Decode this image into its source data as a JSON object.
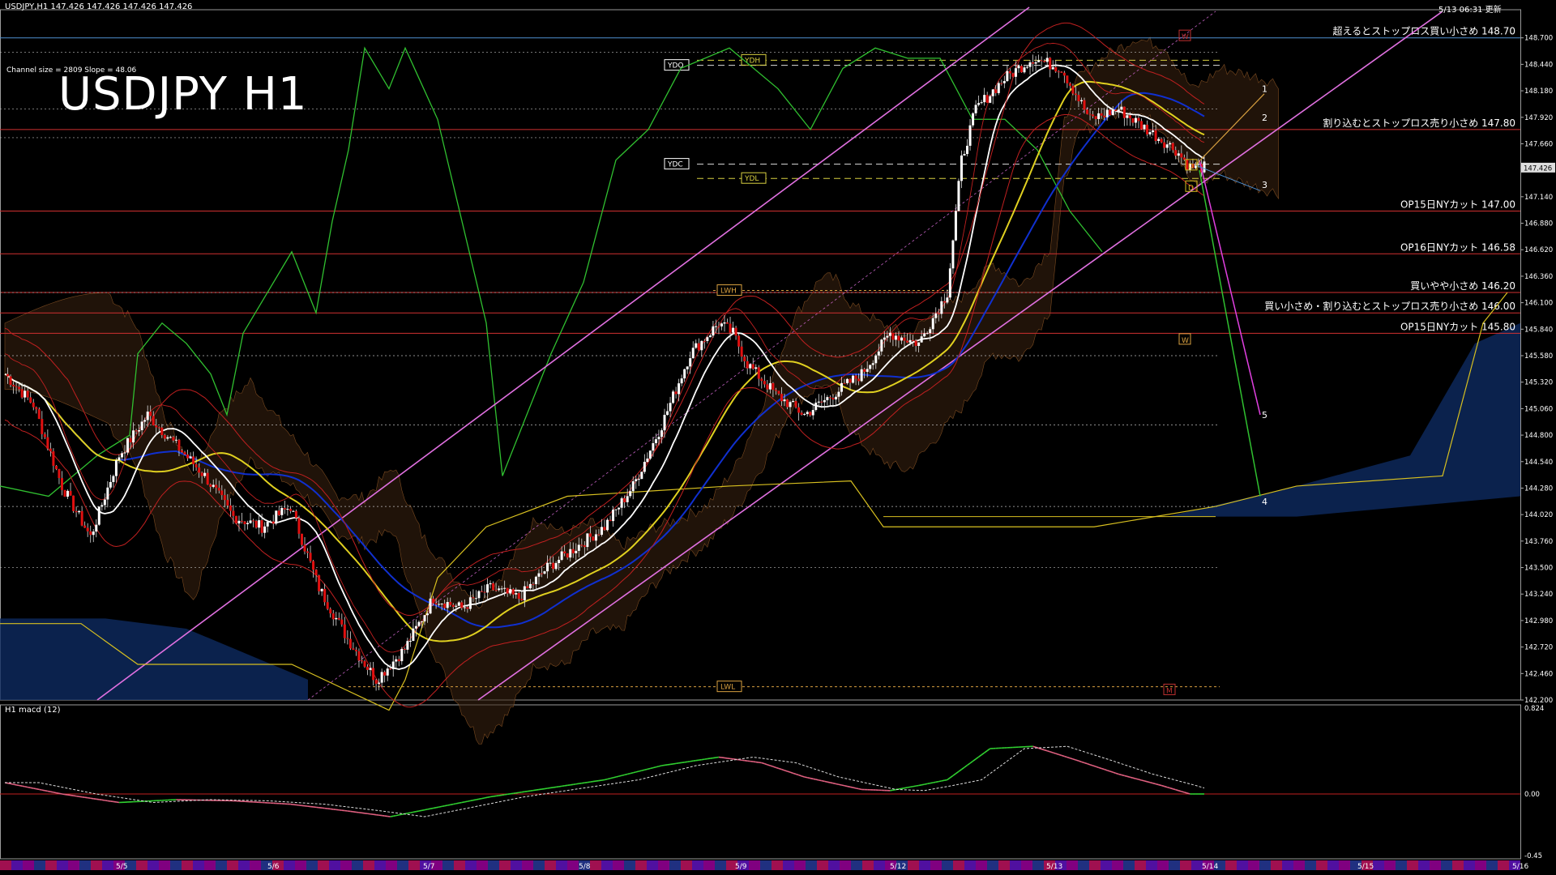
{
  "header": {
    "symbol_line": "USDJPY,H1  147.426 147.426 147.426 147.426",
    "update_time": "5/13 06:31 更新",
    "channel_info": "Channel size = 2809 Slope = 48.06",
    "title": "USDJPY H1",
    "macd_label": "H1  macd (12)"
  },
  "chart_data": {
    "type": "candlestick",
    "title": "USDJPY H1",
    "ylim": [
      142.2,
      148.96
    ],
    "y_ticks": [
      "148.700",
      "148.440",
      "148.180",
      "147.920",
      "147.660",
      "147.426",
      "147.140",
      "146.880",
      "146.620",
      "146.360",
      "146.100",
      "145.840",
      "145.580",
      "145.320",
      "145.060",
      "144.800",
      "144.540",
      "144.280",
      "144.020",
      "143.760",
      "143.500",
      "143.240",
      "142.980",
      "142.720",
      "142.460",
      "142.200"
    ],
    "current_price": "147.426",
    "x_labels": [
      "5/5",
      "5/6",
      "5/7",
      "5/8",
      "5/9",
      "5/12",
      "5/13",
      "5/14",
      "5/15",
      "5/16"
    ],
    "macd_ticks": [
      "0.824",
      "0.00",
      "-0.45"
    ],
    "order_levels": [
      {
        "label": "超えるとストップロス買い小さめ 148.70",
        "price": 148.7,
        "color": "#4f8fd0"
      },
      {
        "label": "割り込むとストップロス売り小さめ 147.80",
        "price": 147.8,
        "color": "#d03030"
      },
      {
        "label": "OP15日NYカット 147.00",
        "price": 147.0,
        "color": "#d03030"
      },
      {
        "label": "OP16日NYカット 146.58",
        "price": 146.58,
        "color": "#d03030"
      },
      {
        "label": "買いやや小さめ 146.20",
        "price": 146.2,
        "color": "#d03030"
      },
      {
        "label": "買い小さめ・割り込むとストップロス売り小さめ 146.00",
        "price": 146.0,
        "color": "#d03030"
      },
      {
        "label": "OP15日NYカット 145.80",
        "price": 145.8,
        "color": "#d03030"
      }
    ],
    "tags": [
      {
        "label": "YDO",
        "price": 148.43
      },
      {
        "label": "YDH",
        "price": 148.48
      },
      {
        "label": "YDC",
        "price": 147.46
      },
      {
        "label": "YDL",
        "price": 147.32
      },
      {
        "label": "LWH",
        "price": 146.22
      },
      {
        "label": "LWL",
        "price": 142.33
      }
    ],
    "markers": [
      "W",
      "D",
      "D",
      "W",
      "M"
    ],
    "wave_labels": [
      "1",
      "2",
      "3",
      "4",
      "5"
    ],
    "anchors": [
      [
        0,
        145.4
      ],
      [
        10,
        145.1
      ],
      [
        20,
        144.3
      ],
      [
        30,
        143.8
      ],
      [
        40,
        144.6
      ],
      [
        50,
        145.0
      ],
      [
        60,
        144.7
      ],
      [
        70,
        144.4
      ],
      [
        80,
        144.0
      ],
      [
        90,
        143.9
      ],
      [
        100,
        144.1
      ],
      [
        110,
        143.3
      ],
      [
        120,
        142.8
      ],
      [
        130,
        142.4
      ],
      [
        140,
        142.7
      ],
      [
        150,
        143.2
      ],
      [
        160,
        143.1
      ],
      [
        170,
        143.3
      ],
      [
        180,
        143.2
      ],
      [
        190,
        143.5
      ],
      [
        200,
        143.7
      ],
      [
        210,
        143.9
      ],
      [
        220,
        144.3
      ],
      [
        230,
        144.9
      ],
      [
        240,
        145.6
      ],
      [
        250,
        145.9
      ],
      [
        255,
        145.8
      ],
      [
        260,
        145.5
      ],
      [
        270,
        145.2
      ],
      [
        280,
        145.0
      ],
      [
        290,
        145.2
      ],
      [
        300,
        145.4
      ],
      [
        310,
        145.8
      ],
      [
        320,
        145.7
      ],
      [
        330,
        146.2
      ],
      [
        335,
        147.5
      ],
      [
        340,
        148.0
      ],
      [
        350,
        148.3
      ],
      [
        360,
        148.5
      ],
      [
        370,
        148.4
      ],
      [
        380,
        147.9
      ],
      [
        390,
        148.0
      ],
      [
        400,
        147.8
      ],
      [
        410,
        147.6
      ],
      [
        415,
        147.43
      ]
    ],
    "macd": [
      [
        0,
        0.2
      ],
      [
        20,
        0.0
      ],
      [
        40,
        -0.15
      ],
      [
        60,
        -0.1
      ],
      [
        80,
        -0.12
      ],
      [
        100,
        -0.18
      ],
      [
        120,
        -0.3
      ],
      [
        135,
        -0.4
      ],
      [
        150,
        -0.25
      ],
      [
        170,
        -0.05
      ],
      [
        190,
        0.1
      ],
      [
        210,
        0.25
      ],
      [
        230,
        0.5
      ],
      [
        250,
        0.65
      ],
      [
        265,
        0.55
      ],
      [
        280,
        0.3
      ],
      [
        300,
        0.08
      ],
      [
        310,
        0.06
      ],
      [
        320,
        0.15
      ],
      [
        330,
        0.25
      ],
      [
        345,
        0.8
      ],
      [
        360,
        0.84
      ],
      [
        375,
        0.6
      ],
      [
        390,
        0.35
      ],
      [
        405,
        0.15
      ],
      [
        415,
        0.0
      ]
    ]
  }
}
